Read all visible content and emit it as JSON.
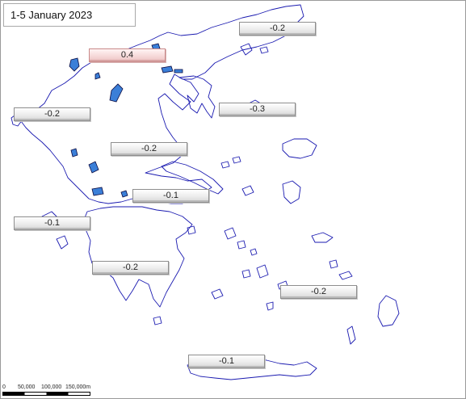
{
  "map": {
    "date_range": "1-5 January 2023",
    "labels": [
      {
        "id": "thrace-east",
        "value": "-0.2"
      },
      {
        "id": "macedonia-west",
        "value": "0.4",
        "highlight": "positive"
      },
      {
        "id": "epirus",
        "value": "-0.2"
      },
      {
        "id": "macedonia-central",
        "value": "-0.3"
      },
      {
        "id": "thessaly",
        "value": "-0.2"
      },
      {
        "id": "central-greece",
        "value": "-0.1"
      },
      {
        "id": "ionian-islands",
        "value": "-0.1"
      },
      {
        "id": "peloponnese",
        "value": "-0.2"
      },
      {
        "id": "aegean-islands",
        "value": "-0.2"
      },
      {
        "id": "crete",
        "value": "-0.1"
      }
    ],
    "scale": {
      "ticks": [
        "0",
        "50,000",
        "100,000",
        "150,000m"
      ]
    },
    "colors": {
      "coastline": "#1a1ab0",
      "lake_fill": "#3b7fd8",
      "positive_label": "#f0c8c8",
      "neutral_label": "#e6e6e6"
    }
  }
}
